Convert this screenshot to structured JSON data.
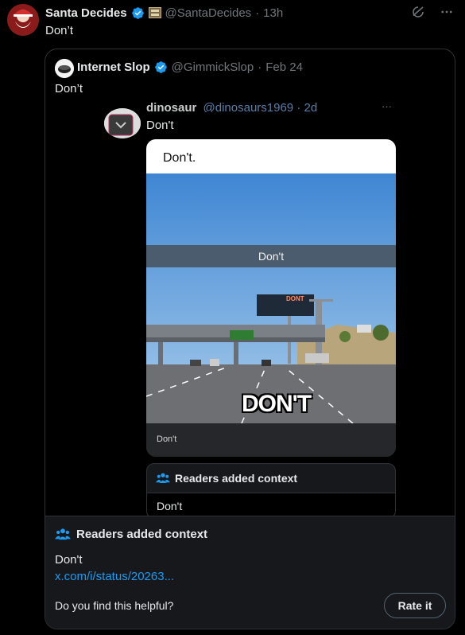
{
  "tweet": {
    "author_name": "Santa Decides",
    "handle": "@SantaDecides",
    "time": "13h",
    "text": "Don’t"
  },
  "quote": {
    "author_name": "Internet Slop",
    "handle": "@GimmickSlop",
    "date": "Feb 24",
    "text": "Don’t"
  },
  "inner": {
    "author_name": "dinosaur",
    "handle": "@dinosaurs1969 · 2d",
    "text": "Don't",
    "meme_caption_top": "Don't.",
    "meme_banner": "Don't",
    "billboard_text": "DONT",
    "big_caption": "DON'T",
    "meme_footer": "Don't",
    "notes_title": "Readers added context",
    "notes_text": "Don't"
  },
  "context": {
    "title": "Readers added context",
    "text": "Don't",
    "link": "x.com/i/status/20263...",
    "question": "Do you find this helpful?",
    "button": "Rate it"
  },
  "colors": {
    "background": "#000000",
    "link": "#1d9bf0",
    "verified": "#1d9bf0",
    "panel": "#16181c"
  },
  "icons": [
    "verified-badge-icon",
    "grok-icon",
    "more-icon",
    "people-icon"
  ]
}
